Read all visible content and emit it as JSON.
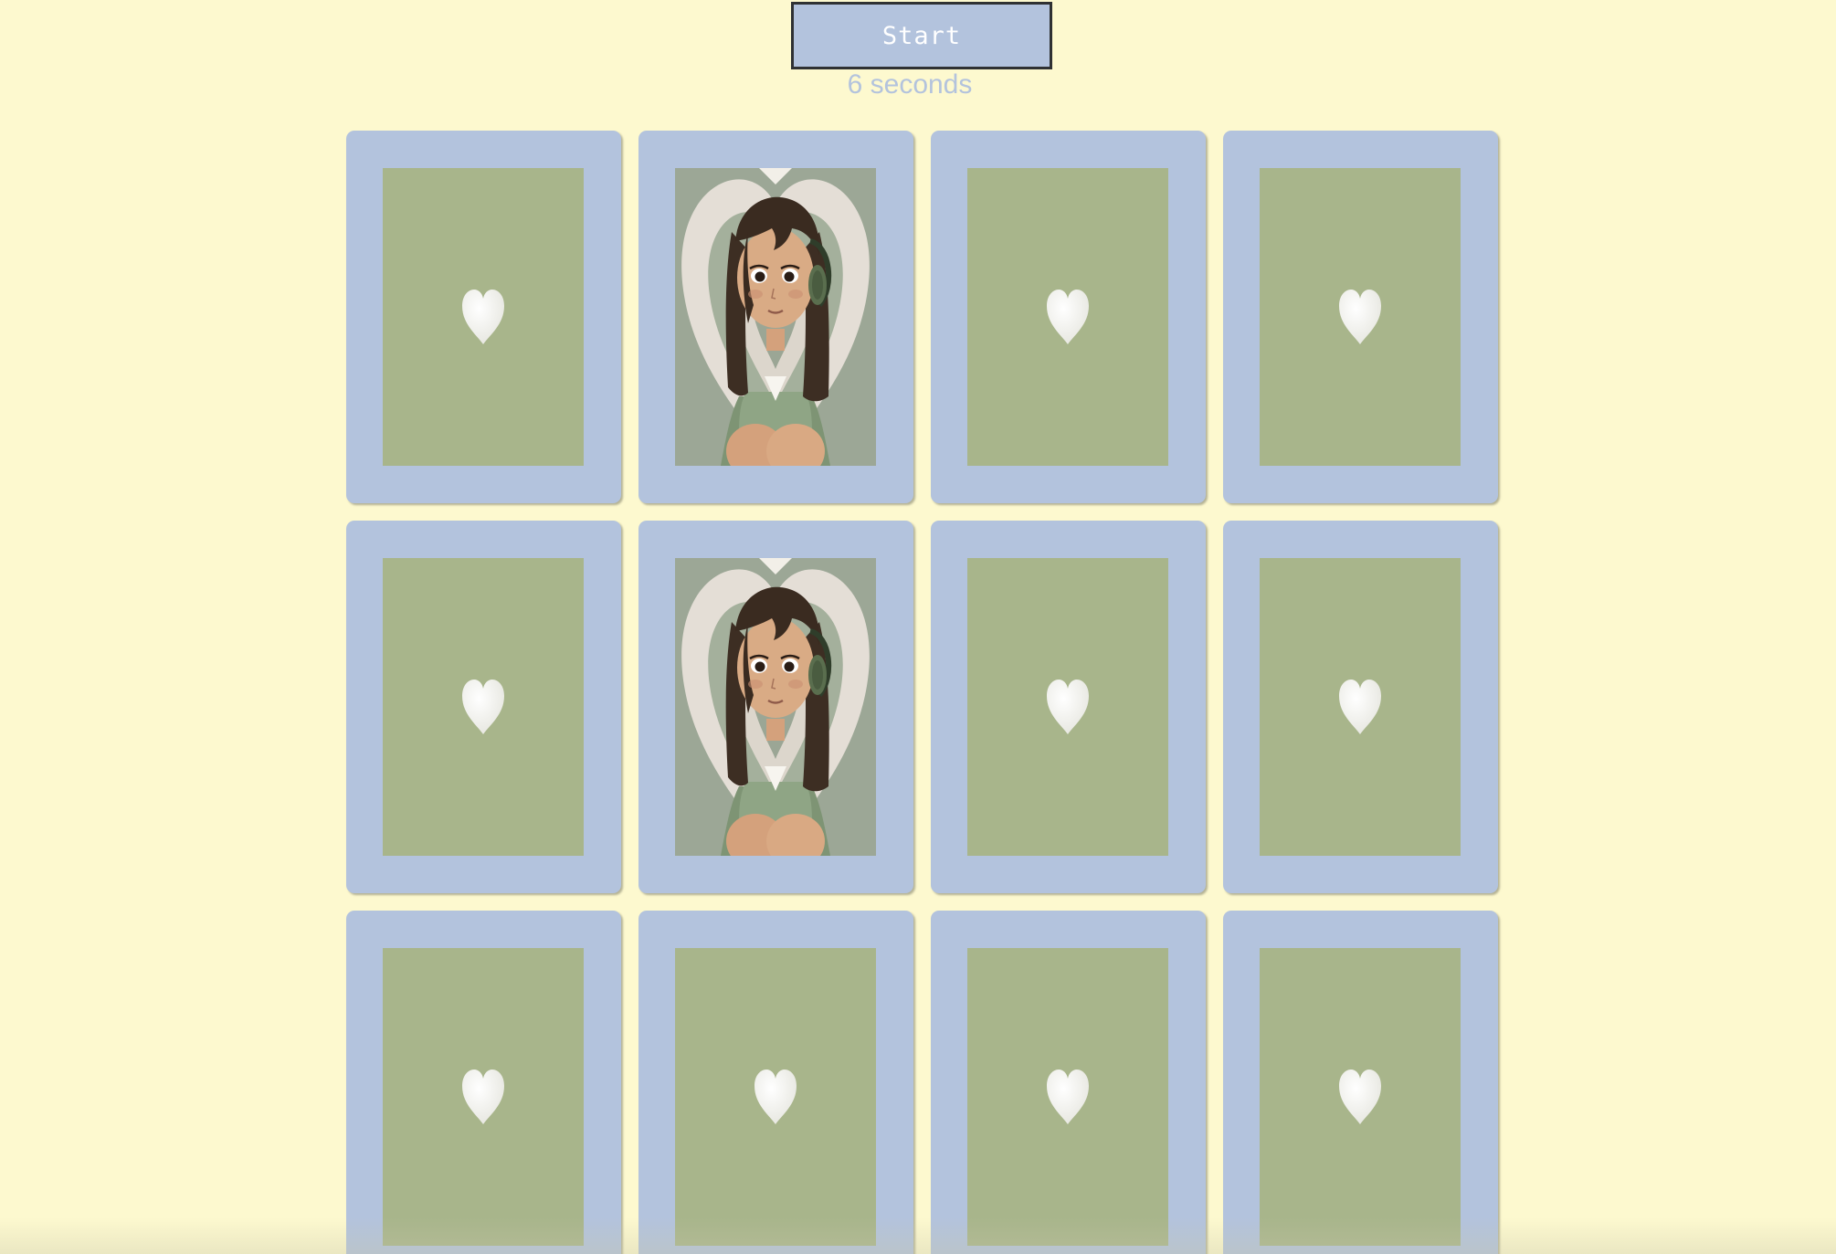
{
  "controls": {
    "start_label": "Start",
    "timer_text": "6 seconds"
  },
  "colors": {
    "background": "#fdf9cf",
    "card_border": "#b3c3dd",
    "card_back": "#a8b58b",
    "heart": "#f3f3ef",
    "button_border": "#2f3133"
  },
  "cards": [
    {
      "state": "face-down",
      "icon": "heart-icon"
    },
    {
      "state": "face-up",
      "image": "girl-with-headphones-portrait"
    },
    {
      "state": "face-down",
      "icon": "heart-icon"
    },
    {
      "state": "face-down",
      "icon": "heart-icon"
    },
    {
      "state": "face-down",
      "icon": "heart-icon"
    },
    {
      "state": "face-up",
      "image": "girl-with-headphones-portrait"
    },
    {
      "state": "face-down",
      "icon": "heart-icon"
    },
    {
      "state": "face-down",
      "icon": "heart-icon"
    },
    {
      "state": "face-down",
      "icon": "heart-icon"
    },
    {
      "state": "face-down",
      "icon": "heart-icon"
    },
    {
      "state": "face-down",
      "icon": "heart-icon"
    },
    {
      "state": "face-down",
      "icon": "heart-icon"
    }
  ]
}
